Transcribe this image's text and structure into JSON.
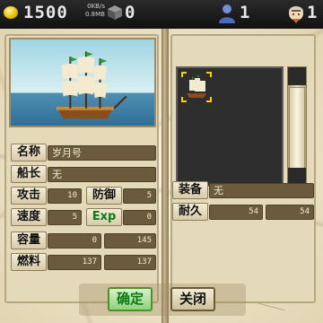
{
  "status_bar": {
    "gold": "1500",
    "net_speed": "0KB/s",
    "memory": "0.8MB",
    "cubes": "0",
    "crew": "1",
    "captains": "1"
  },
  "ship": {
    "name_label": "名称",
    "name": "岁月号",
    "captain_label": "船长",
    "captain": "无",
    "attack_label": "攻击",
    "attack": "10",
    "defense_label": "防御",
    "defense": "5",
    "speed_label": "速度",
    "speed": "5",
    "exp_label": "Exp",
    "exp": "0",
    "capacity_label": "容量",
    "capacity_current": "0",
    "capacity_max": "145",
    "fuel_label": "燃料",
    "fuel_current": "137",
    "fuel_max": "137"
  },
  "equipment": {
    "equip_label": "装备",
    "equip_value": "无",
    "durability_label": "耐久",
    "durability_current": "54",
    "durability_max": "54"
  },
  "buttons": {
    "confirm": "确定",
    "close": "关闭"
  },
  "icons": {
    "gold": "gold-coin-icon",
    "cube": "cube-icon",
    "crew": "crew-person-icon",
    "captain": "captain-icon",
    "ship": "sailing-ship-icon"
  },
  "colors": {
    "parchment": "#efe6cc",
    "confirm_text": "#0a7a10",
    "exp_text": "#0c7a18",
    "slot_highlight": "#f2d200"
  }
}
